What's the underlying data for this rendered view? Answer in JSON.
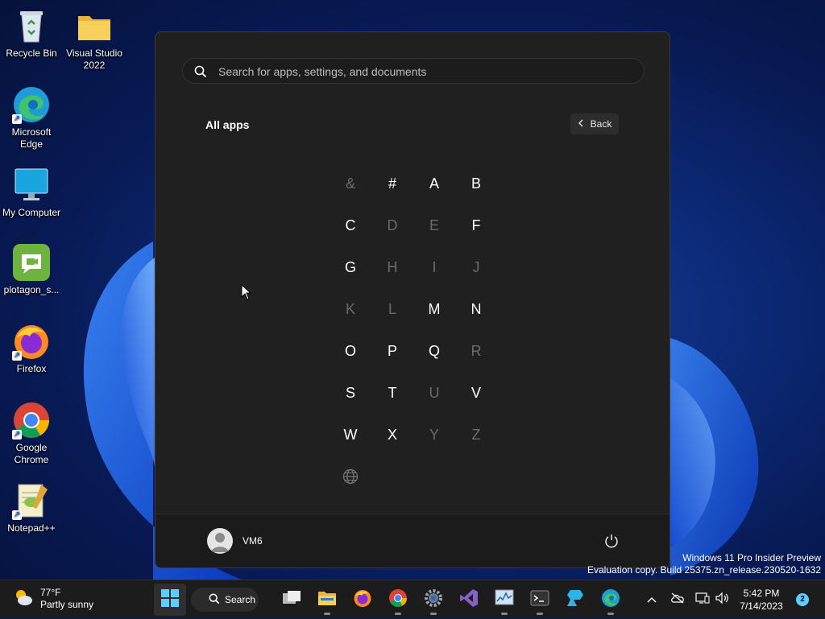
{
  "desktop": {
    "icons": [
      {
        "label": "Recycle Bin",
        "icon": "recycle-bin-icon"
      },
      {
        "label": "Visual Studio 2022",
        "icon": "folder-icon"
      },
      {
        "label": "Microsoft Edge",
        "icon": "edge-icon"
      },
      {
        "label": "My Computer",
        "icon": "monitor-icon"
      },
      {
        "label": "plotagon_s...",
        "icon": "plotagon-icon"
      },
      {
        "label": "Firefox",
        "icon": "firefox-icon"
      },
      {
        "label": "Google Chrome",
        "icon": "chrome-icon"
      },
      {
        "label": "Notepad++",
        "icon": "notepad-plus-plus-icon"
      }
    ]
  },
  "start_menu": {
    "search_placeholder": "Search for apps, settings, and documents",
    "title": "All apps",
    "back_label": "Back",
    "letters": [
      {
        "char": "&",
        "enabled": false
      },
      {
        "char": "#",
        "enabled": true
      },
      {
        "char": "A",
        "enabled": true
      },
      {
        "char": "B",
        "enabled": true
      },
      {
        "char": "C",
        "enabled": true
      },
      {
        "char": "D",
        "enabled": false
      },
      {
        "char": "E",
        "enabled": false
      },
      {
        "char": "F",
        "enabled": true
      },
      {
        "char": "G",
        "enabled": true
      },
      {
        "char": "H",
        "enabled": false
      },
      {
        "char": "I",
        "enabled": false
      },
      {
        "char": "J",
        "enabled": false
      },
      {
        "char": "K",
        "enabled": false
      },
      {
        "char": "L",
        "enabled": false
      },
      {
        "char": "M",
        "enabled": true
      },
      {
        "char": "N",
        "enabled": true
      },
      {
        "char": "O",
        "enabled": true
      },
      {
        "char": "P",
        "enabled": true
      },
      {
        "char": "Q",
        "enabled": true
      },
      {
        "char": "R",
        "enabled": false
      },
      {
        "char": "S",
        "enabled": true
      },
      {
        "char": "T",
        "enabled": true
      },
      {
        "char": "U",
        "enabled": false
      },
      {
        "char": "V",
        "enabled": true
      },
      {
        "char": "W",
        "enabled": true
      },
      {
        "char": "X",
        "enabled": true
      },
      {
        "char": "Y",
        "enabled": false
      },
      {
        "char": "Z",
        "enabled": false
      }
    ],
    "globe_icon": "globe-icon",
    "user_name": "VM6"
  },
  "watermark": {
    "line1": "Windows 11 Pro Insider Preview",
    "line2": "Evaluation copy. Build 25375.zn_release.230520-1632"
  },
  "taskbar": {
    "weather_temp": "77°F",
    "weather_desc": "Partly sunny",
    "search_label": "Search",
    "apps": [
      "start-icon",
      "task-view-icon",
      "file-explorer-icon",
      "firefox-icon",
      "chrome-icon",
      "settings-icon",
      "visual-studio-icon",
      "resource-monitor-icon",
      "terminal-icon",
      "azure-data-studio-icon",
      "edge-icon"
    ],
    "time": "5:42 PM",
    "date": "7/14/2023",
    "notification_count": "2"
  },
  "colors": {
    "accent": "#60cdff",
    "start_bg": "#202020",
    "taskbar_bg": "#1c1c1c"
  }
}
